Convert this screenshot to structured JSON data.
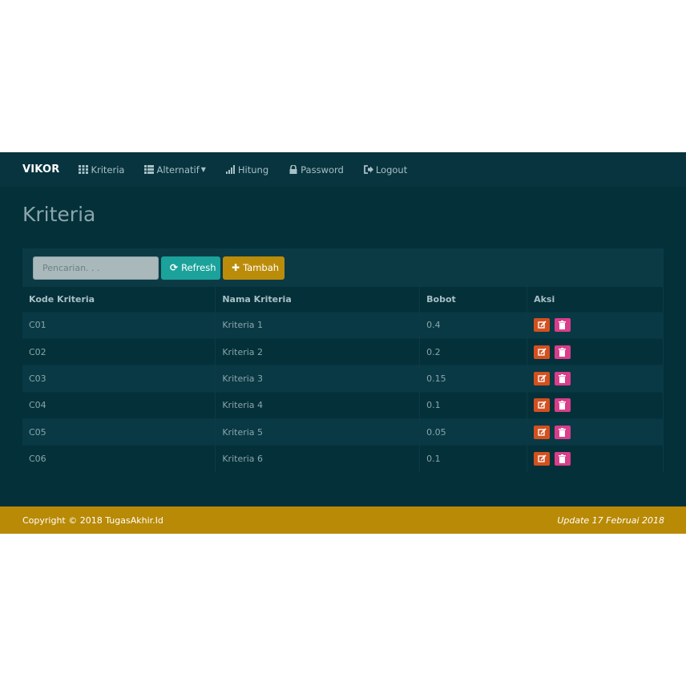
{
  "navbar": {
    "brand": "VIKOR",
    "items": [
      {
        "label": "Kriteria",
        "icon": "grid-icon"
      },
      {
        "label": "Alternatif",
        "icon": "list-icon"
      },
      {
        "label": "Hitung",
        "icon": "signal-icon"
      },
      {
        "label": "Password",
        "icon": "lock-icon"
      },
      {
        "label": "Logout",
        "icon": "logout-icon"
      }
    ]
  },
  "page": {
    "title": "Kriteria"
  },
  "toolbar": {
    "search_placeholder": "Pencarian. . .",
    "refresh_label": "Refresh",
    "tambah_label": "Tambah"
  },
  "table": {
    "headers": [
      "Kode Kriteria",
      "Nama Kriteria",
      "Bobot",
      "Aksi"
    ],
    "rows": [
      {
        "kode": "C01",
        "nama": "Kriteria 1",
        "bobot": "0.4"
      },
      {
        "kode": "C02",
        "nama": "Kriteria 2",
        "bobot": "0.2"
      },
      {
        "kode": "C03",
        "nama": "Kriteria 3",
        "bobot": "0.15"
      },
      {
        "kode": "C04",
        "nama": "Kriteria 4",
        "bobot": "0.1"
      },
      {
        "kode": "C05",
        "nama": "Kriteria 5",
        "bobot": "0.05"
      },
      {
        "kode": "C06",
        "nama": "Kriteria 6",
        "bobot": "0.1"
      }
    ]
  },
  "footer": {
    "copyright": "Copyright © 2018 TugasAkhir.Id",
    "update": "Update 17 Februai 2018"
  },
  "colors": {
    "background": "#04303a",
    "navbar": "#07343f",
    "refresh": "#1ba29a",
    "tambah": "#bb8c0a",
    "edit": "#d3501f",
    "delete": "#d93e8a",
    "footer": "#b98a05"
  }
}
